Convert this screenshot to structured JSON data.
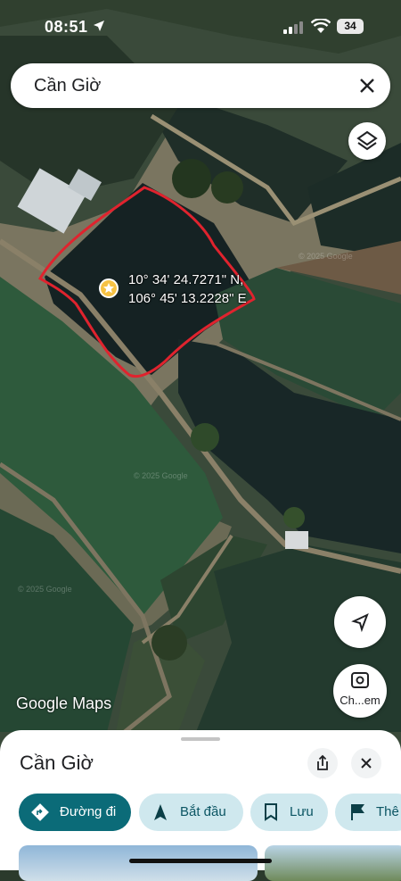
{
  "status_bar": {
    "time": "08:51",
    "battery": "34"
  },
  "search": {
    "query": "Cần Giờ"
  },
  "map": {
    "coordinates": {
      "lat": "10° 34' 24.7271\" N,",
      "lng": "106° 45' 13.2228\" E"
    },
    "watermark": "© 2025 Google",
    "attribution_prefix": "Google",
    "attribution_suffix": "Maps"
  },
  "controls": {
    "lens_label": "Ch...em"
  },
  "sheet": {
    "title": "Cần Giờ",
    "chips": [
      {
        "label": "Đường đi",
        "icon": "directions-icon"
      },
      {
        "label": "Bắt đầu",
        "icon": "navigation-arrow-icon"
      },
      {
        "label": "Lưu",
        "icon": "bookmark-icon"
      },
      {
        "label": "Thê",
        "icon": "flag-icon"
      }
    ]
  },
  "colors": {
    "accent": "#0b6b78",
    "chip_bg": "#cfe8ee",
    "outline": "#e0232e",
    "pin": "#f6c244"
  }
}
